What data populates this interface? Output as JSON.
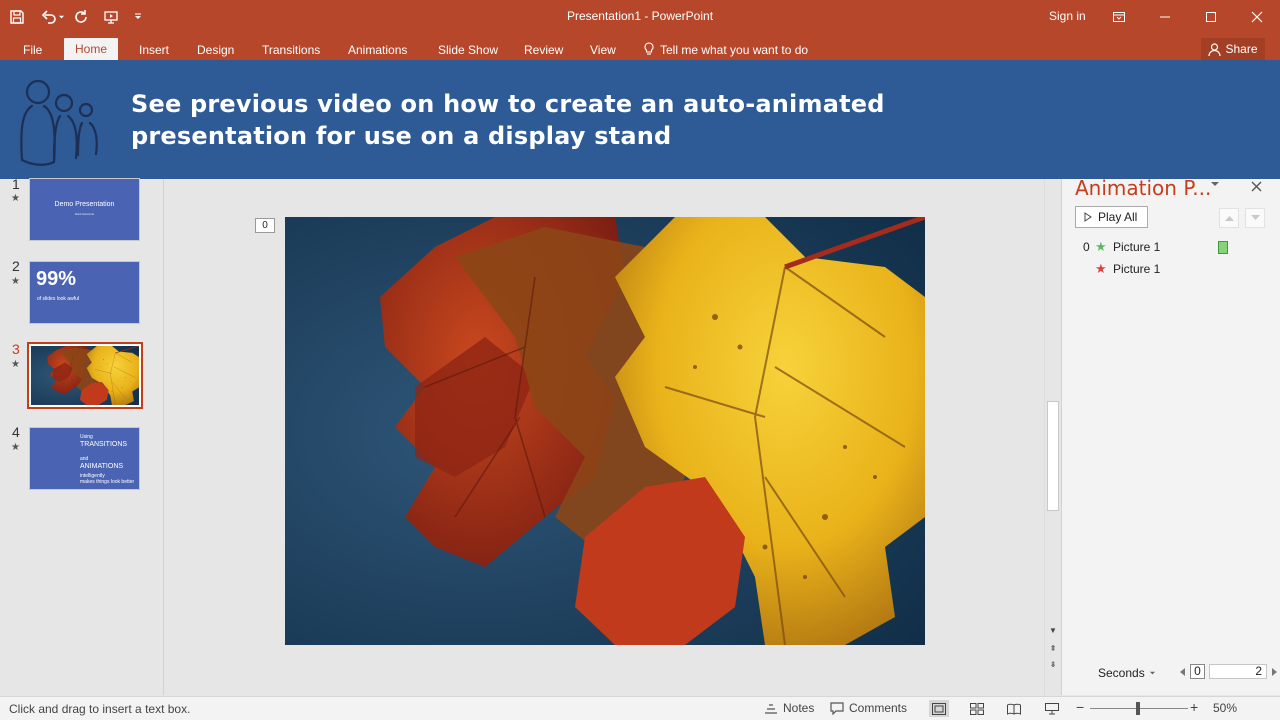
{
  "window": {
    "title": "Presentation1 - PowerPoint",
    "sign_in": "Sign in"
  },
  "ribbon": {
    "tabs": [
      "File",
      "Home",
      "Insert",
      "Design",
      "Transitions",
      "Animations",
      "Slide Show",
      "Review",
      "View"
    ],
    "active_tab": "Home",
    "tell_me": "Tell me what you want to do",
    "share": "Share"
  },
  "banner": {
    "line1": "See previous video on how to create an auto-animated",
    "line2": "presentation for use on a display stand"
  },
  "slides": [
    {
      "number": "1",
      "title": "Demo Presentation",
      "subtitle": "Mark Edwards"
    },
    {
      "number": "2",
      "big": "99%",
      "subtitle": "of slides look awful"
    },
    {
      "number": "3"
    },
    {
      "number": "4",
      "l1": "Using",
      "l2": "TRANSITIONS",
      "l3": "and",
      "l4": "ANIMATIONS",
      "l5": "intelligently",
      "l6": "makes things look better"
    }
  ],
  "editor": {
    "anim_tag": "0"
  },
  "animation_pane": {
    "title": "Animation P...",
    "play_all": "Play All",
    "items": [
      {
        "index": "0",
        "name": "Picture 1",
        "star_color": "#5fb86a"
      },
      {
        "index": "",
        "name": "Picture 1",
        "star_color": "#d9453a"
      }
    ],
    "seconds_label": "Seconds",
    "timeline_start": "0",
    "timeline_end": "2"
  },
  "status": {
    "hint": "Click and drag to insert a text box.",
    "notes": "Notes",
    "comments": "Comments",
    "zoom": "50%"
  },
  "colors": {
    "accent": "#b7472a",
    "banner": "#2e5a95",
    "thumb_blue": "#4a64b3"
  }
}
